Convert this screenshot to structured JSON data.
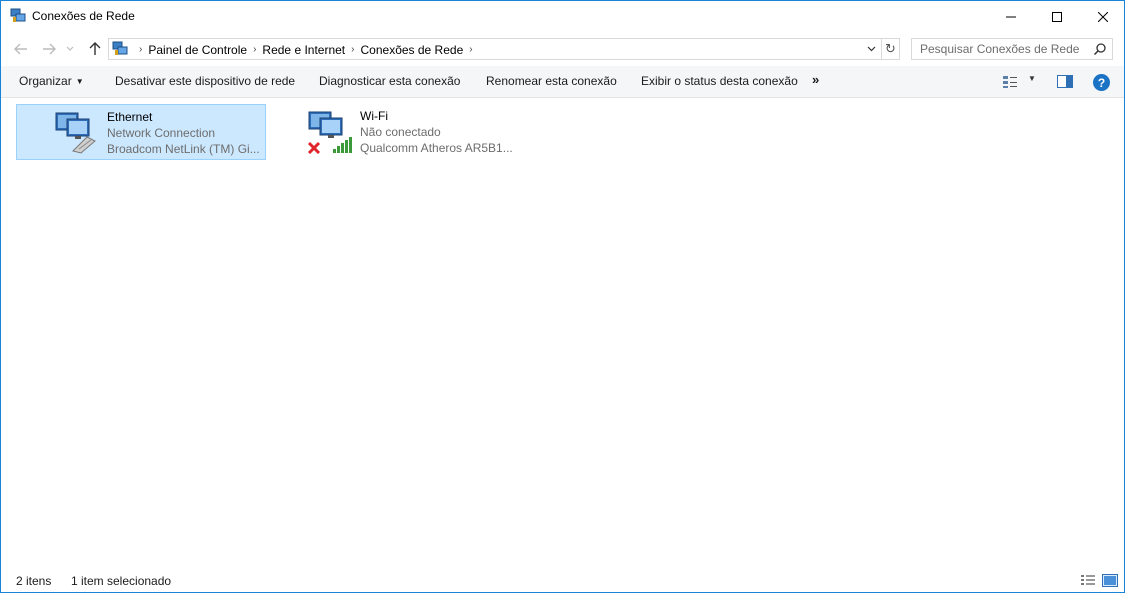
{
  "window": {
    "title": "Conexões de Rede",
    "controls": {
      "minimize_icon": "minimize-icon",
      "maximize_icon": "maximize-icon",
      "close_icon": "close-icon"
    }
  },
  "navigation": {
    "back_icon": "arrow-left-icon",
    "forward_icon": "arrow-right-icon",
    "recent_icon": "chevron-down-icon",
    "up_icon": "arrow-up-icon",
    "breadcrumbs": [
      {
        "label": "Painel de Controle"
      },
      {
        "label": "Rede e Internet"
      },
      {
        "label": "Conexões de Rede"
      }
    ],
    "refresh_icon": "refresh-icon",
    "search": {
      "placeholder": "Pesquisar Conexões de Rede",
      "value": ""
    }
  },
  "toolbar": {
    "organize": "Organizar",
    "disable": "Desativar este dispositivo de rede",
    "diagnose": "Diagnosticar esta conexão",
    "rename": "Renomear esta conexão",
    "status": "Exibir o status desta conexão",
    "more": "»"
  },
  "items": [
    {
      "name": "Ethernet",
      "line1": "Network Connection",
      "line2": "Broadcom NetLink (TM) Gi...",
      "selected": true,
      "icon": "ethernet-adapter-icon"
    },
    {
      "name": "Wi-Fi",
      "line1": "Não conectado",
      "line2": "Qualcomm Atheros AR5B1...",
      "selected": false,
      "icon": "wifi-adapter-icon",
      "status_icon": "disconnected-x-icon"
    }
  ],
  "statusbar": {
    "count": "2 itens",
    "selection": "1 item selecionado"
  },
  "colors": {
    "accent": "#1883d7",
    "selection_bg": "#cce8ff",
    "selection_border": "#99d1ff",
    "help": "#1a73c4"
  }
}
